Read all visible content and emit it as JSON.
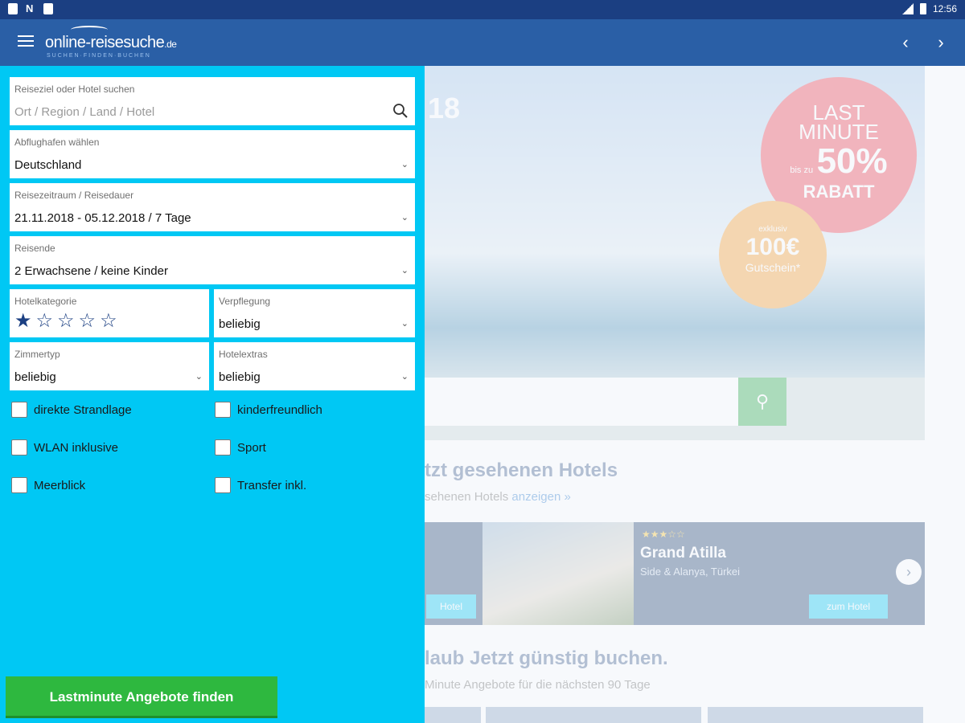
{
  "statusbar": {
    "time": "12:56",
    "notification_letter": "N"
  },
  "appbar": {
    "logo_text": "online-reisesuche",
    "logo_tld": ".de",
    "logo_tagline": "SUCHEN·FINDEN·BUCHEN",
    "prev_icon": "chevron-left-icon",
    "next_icon": "chevron-right-icon"
  },
  "background": {
    "hero_year": "18",
    "badge_red": {
      "line1": "LAST",
      "line2": "MINUTE",
      "prefix": "bis zu",
      "percent": "50%",
      "line3": "RABATT"
    },
    "badge_orange": {
      "top": "exklusiv",
      "amount": "100€",
      "bottom": "Gutschein*"
    },
    "recent_title": "tzt gesehenen Hotels",
    "recent_sub": "sehenen Hotels",
    "recent_link": "anzeigen »",
    "hotel": {
      "stars": "★★★☆☆",
      "name": "Grand Atilla",
      "location": "Side & Alanya, Türkei",
      "button": "zum Hotel",
      "left_button": "Hotel"
    },
    "offers_title": "laub Jetzt günstig buchen.",
    "offers_sub": "Minute Angebote für die nächsten 90 Tage"
  },
  "drawer": {
    "destination": {
      "label": "Reiseziel oder Hotel suchen",
      "placeholder": "Ort / Region / Land / Hotel"
    },
    "airport": {
      "label": "Abflughafen wählen",
      "value": "Deutschland"
    },
    "period": {
      "label": "Reisezeitraum / Reisedauer",
      "value": "21.11.2018 - 05.12.2018 / 7 Tage"
    },
    "travelers": {
      "label": "Reisende",
      "value": "2 Erwachsene / keine Kinder"
    },
    "hotel_category": {
      "label": "Hotelkategorie",
      "rating": 1,
      "max": 5
    },
    "board": {
      "label": "Verpflegung",
      "value": "beliebig"
    },
    "room_type": {
      "label": "Zimmertyp",
      "value": "beliebig"
    },
    "hotel_extras": {
      "label": "Hotelextras",
      "value": "beliebig"
    },
    "checkboxes": [
      {
        "label": "direkte Strandlage",
        "checked": false
      },
      {
        "label": "kinderfreundlich",
        "checked": false
      },
      {
        "label": "WLAN inklusive",
        "checked": false
      },
      {
        "label": "Sport",
        "checked": false
      },
      {
        "label": "Meerblick",
        "checked": false
      },
      {
        "label": "Transfer inkl.",
        "checked": false
      }
    ],
    "cta": "Lastminute Angebote finden"
  }
}
